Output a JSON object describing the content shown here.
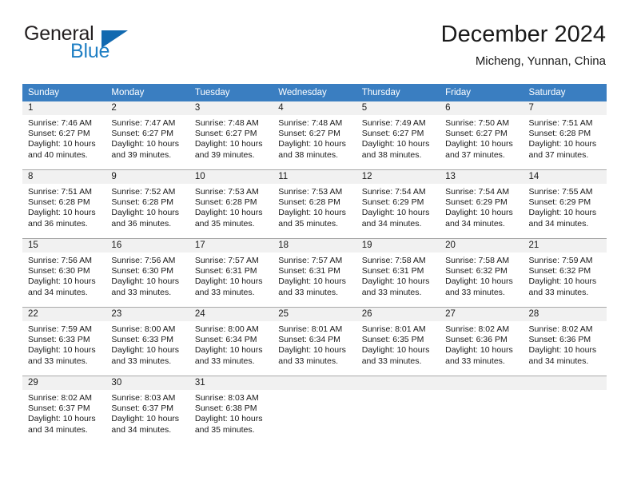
{
  "brand": {
    "name_part1": "General",
    "name_part2": "Blue",
    "flag_icon": "triangle-flag-icon"
  },
  "header": {
    "title": "December 2024",
    "location": "Micheng, Yunnan, China"
  },
  "theme": {
    "header_blue": "#3a7ec1",
    "brand_blue": "#1f7fc4",
    "flag_blue": "#1169b0",
    "daynum_band": "#f1f1f1",
    "grid_line": "#a9a9a9"
  },
  "weekdays": [
    "Sunday",
    "Monday",
    "Tuesday",
    "Wednesday",
    "Thursday",
    "Friday",
    "Saturday"
  ],
  "labels": {
    "sunrise_prefix": "Sunrise:",
    "sunset_prefix": "Sunset:",
    "daylight_prefix": "Daylight:"
  },
  "weeks": [
    [
      {
        "day": "1",
        "sunrise": "Sunrise: 7:46 AM",
        "sunset": "Sunset: 6:27 PM",
        "daylight1": "Daylight: 10 hours",
        "daylight2": "and 40 minutes."
      },
      {
        "day": "2",
        "sunrise": "Sunrise: 7:47 AM",
        "sunset": "Sunset: 6:27 PM",
        "daylight1": "Daylight: 10 hours",
        "daylight2": "and 39 minutes."
      },
      {
        "day": "3",
        "sunrise": "Sunrise: 7:48 AM",
        "sunset": "Sunset: 6:27 PM",
        "daylight1": "Daylight: 10 hours",
        "daylight2": "and 39 minutes."
      },
      {
        "day": "4",
        "sunrise": "Sunrise: 7:48 AM",
        "sunset": "Sunset: 6:27 PM",
        "daylight1": "Daylight: 10 hours",
        "daylight2": "and 38 minutes."
      },
      {
        "day": "5",
        "sunrise": "Sunrise: 7:49 AM",
        "sunset": "Sunset: 6:27 PM",
        "daylight1": "Daylight: 10 hours",
        "daylight2": "and 38 minutes."
      },
      {
        "day": "6",
        "sunrise": "Sunrise: 7:50 AM",
        "sunset": "Sunset: 6:27 PM",
        "daylight1": "Daylight: 10 hours",
        "daylight2": "and 37 minutes."
      },
      {
        "day": "7",
        "sunrise": "Sunrise: 7:51 AM",
        "sunset": "Sunset: 6:28 PM",
        "daylight1": "Daylight: 10 hours",
        "daylight2": "and 37 minutes."
      }
    ],
    [
      {
        "day": "8",
        "sunrise": "Sunrise: 7:51 AM",
        "sunset": "Sunset: 6:28 PM",
        "daylight1": "Daylight: 10 hours",
        "daylight2": "and 36 minutes."
      },
      {
        "day": "9",
        "sunrise": "Sunrise: 7:52 AM",
        "sunset": "Sunset: 6:28 PM",
        "daylight1": "Daylight: 10 hours",
        "daylight2": "and 36 minutes."
      },
      {
        "day": "10",
        "sunrise": "Sunrise: 7:53 AM",
        "sunset": "Sunset: 6:28 PM",
        "daylight1": "Daylight: 10 hours",
        "daylight2": "and 35 minutes."
      },
      {
        "day": "11",
        "sunrise": "Sunrise: 7:53 AM",
        "sunset": "Sunset: 6:28 PM",
        "daylight1": "Daylight: 10 hours",
        "daylight2": "and 35 minutes."
      },
      {
        "day": "12",
        "sunrise": "Sunrise: 7:54 AM",
        "sunset": "Sunset: 6:29 PM",
        "daylight1": "Daylight: 10 hours",
        "daylight2": "and 34 minutes."
      },
      {
        "day": "13",
        "sunrise": "Sunrise: 7:54 AM",
        "sunset": "Sunset: 6:29 PM",
        "daylight1": "Daylight: 10 hours",
        "daylight2": "and 34 minutes."
      },
      {
        "day": "14",
        "sunrise": "Sunrise: 7:55 AM",
        "sunset": "Sunset: 6:29 PM",
        "daylight1": "Daylight: 10 hours",
        "daylight2": "and 34 minutes."
      }
    ],
    [
      {
        "day": "15",
        "sunrise": "Sunrise: 7:56 AM",
        "sunset": "Sunset: 6:30 PM",
        "daylight1": "Daylight: 10 hours",
        "daylight2": "and 34 minutes."
      },
      {
        "day": "16",
        "sunrise": "Sunrise: 7:56 AM",
        "sunset": "Sunset: 6:30 PM",
        "daylight1": "Daylight: 10 hours",
        "daylight2": "and 33 minutes."
      },
      {
        "day": "17",
        "sunrise": "Sunrise: 7:57 AM",
        "sunset": "Sunset: 6:31 PM",
        "daylight1": "Daylight: 10 hours",
        "daylight2": "and 33 minutes."
      },
      {
        "day": "18",
        "sunrise": "Sunrise: 7:57 AM",
        "sunset": "Sunset: 6:31 PM",
        "daylight1": "Daylight: 10 hours",
        "daylight2": "and 33 minutes."
      },
      {
        "day": "19",
        "sunrise": "Sunrise: 7:58 AM",
        "sunset": "Sunset: 6:31 PM",
        "daylight1": "Daylight: 10 hours",
        "daylight2": "and 33 minutes."
      },
      {
        "day": "20",
        "sunrise": "Sunrise: 7:58 AM",
        "sunset": "Sunset: 6:32 PM",
        "daylight1": "Daylight: 10 hours",
        "daylight2": "and 33 minutes."
      },
      {
        "day": "21",
        "sunrise": "Sunrise: 7:59 AM",
        "sunset": "Sunset: 6:32 PM",
        "daylight1": "Daylight: 10 hours",
        "daylight2": "and 33 minutes."
      }
    ],
    [
      {
        "day": "22",
        "sunrise": "Sunrise: 7:59 AM",
        "sunset": "Sunset: 6:33 PM",
        "daylight1": "Daylight: 10 hours",
        "daylight2": "and 33 minutes."
      },
      {
        "day": "23",
        "sunrise": "Sunrise: 8:00 AM",
        "sunset": "Sunset: 6:33 PM",
        "daylight1": "Daylight: 10 hours",
        "daylight2": "and 33 minutes."
      },
      {
        "day": "24",
        "sunrise": "Sunrise: 8:00 AM",
        "sunset": "Sunset: 6:34 PM",
        "daylight1": "Daylight: 10 hours",
        "daylight2": "and 33 minutes."
      },
      {
        "day": "25",
        "sunrise": "Sunrise: 8:01 AM",
        "sunset": "Sunset: 6:34 PM",
        "daylight1": "Daylight: 10 hours",
        "daylight2": "and 33 minutes."
      },
      {
        "day": "26",
        "sunrise": "Sunrise: 8:01 AM",
        "sunset": "Sunset: 6:35 PM",
        "daylight1": "Daylight: 10 hours",
        "daylight2": "and 33 minutes."
      },
      {
        "day": "27",
        "sunrise": "Sunrise: 8:02 AM",
        "sunset": "Sunset: 6:36 PM",
        "daylight1": "Daylight: 10 hours",
        "daylight2": "and 33 minutes."
      },
      {
        "day": "28",
        "sunrise": "Sunrise: 8:02 AM",
        "sunset": "Sunset: 6:36 PM",
        "daylight1": "Daylight: 10 hours",
        "daylight2": "and 34 minutes."
      }
    ],
    [
      {
        "day": "29",
        "sunrise": "Sunrise: 8:02 AM",
        "sunset": "Sunset: 6:37 PM",
        "daylight1": "Daylight: 10 hours",
        "daylight2": "and 34 minutes."
      },
      {
        "day": "30",
        "sunrise": "Sunrise: 8:03 AM",
        "sunset": "Sunset: 6:37 PM",
        "daylight1": "Daylight: 10 hours",
        "daylight2": "and 34 minutes."
      },
      {
        "day": "31",
        "sunrise": "Sunrise: 8:03 AM",
        "sunset": "Sunset: 6:38 PM",
        "daylight1": "Daylight: 10 hours",
        "daylight2": "and 35 minutes."
      },
      {
        "day": "",
        "sunrise": "",
        "sunset": "",
        "daylight1": "",
        "daylight2": ""
      },
      {
        "day": "",
        "sunrise": "",
        "sunset": "",
        "daylight1": "",
        "daylight2": ""
      },
      {
        "day": "",
        "sunrise": "",
        "sunset": "",
        "daylight1": "",
        "daylight2": ""
      },
      {
        "day": "",
        "sunrise": "",
        "sunset": "",
        "daylight1": "",
        "daylight2": ""
      }
    ]
  ]
}
